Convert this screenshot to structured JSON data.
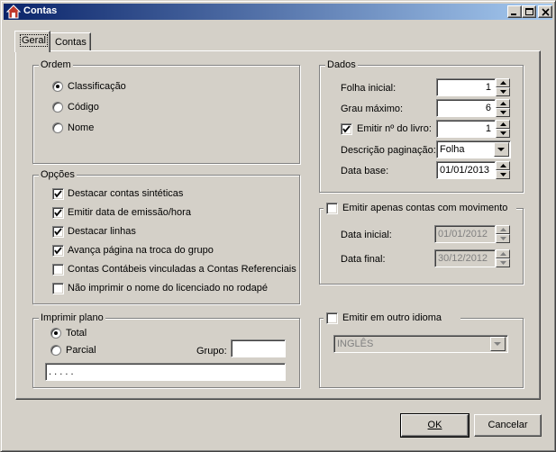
{
  "window": {
    "title": "Contas",
    "icon": "house-icon"
  },
  "tabs": [
    {
      "label": "Geral"
    },
    {
      "label": "Contas"
    }
  ],
  "ordem": {
    "title": "Ordem",
    "options": [
      {
        "label": "Classificação",
        "selected": true
      },
      {
        "label": "Código",
        "selected": false
      },
      {
        "label": "Nome",
        "selected": false
      }
    ]
  },
  "opcoes": {
    "title": "Opções",
    "items": [
      {
        "label": "Destacar contas sintéticas",
        "checked": true
      },
      {
        "label": "Emitir data de emissão/hora",
        "checked": true
      },
      {
        "label": "Destacar linhas",
        "checked": true
      },
      {
        "label": "Avança página na troca do grupo",
        "checked": true
      },
      {
        "label": "Contas Contábeis vinculadas a Contas Referenciais",
        "checked": false
      },
      {
        "label": "Não imprimir o nome do licenciado no rodapé",
        "checked": false
      }
    ]
  },
  "imprimir": {
    "title": "Imprimir plano",
    "total_label": "Total",
    "parcial_label": "Parcial",
    "selected": "Total",
    "grupo_label": "Grupo:",
    "grupo_value": "",
    "mask_value": ". . .  .  ."
  },
  "dados": {
    "title": "Dados",
    "folha_label": "Folha inicial:",
    "folha_value": "1",
    "grau_label": "Grau máximo:",
    "grau_value": "6",
    "livro_label": "Emitir nº do livro:",
    "livro_checked": true,
    "livro_value": "1",
    "descricao_label": "Descrição paginação:",
    "descricao_value": "Folha",
    "data_base_label": "Data base:",
    "data_base_value": "01/01/2013"
  },
  "movimento": {
    "title": "Emitir apenas contas com movimento",
    "checked": false,
    "data_inicial_label": "Data inicial:",
    "data_inicial_value": "01/01/2012",
    "data_final_label": "Data final:",
    "data_final_value": "30/12/2012"
  },
  "idioma": {
    "title": "Emitir em outro idioma",
    "checked": false,
    "value": "INGLÊS"
  },
  "buttons": {
    "ok": "OK",
    "cancel": "Cancelar"
  }
}
